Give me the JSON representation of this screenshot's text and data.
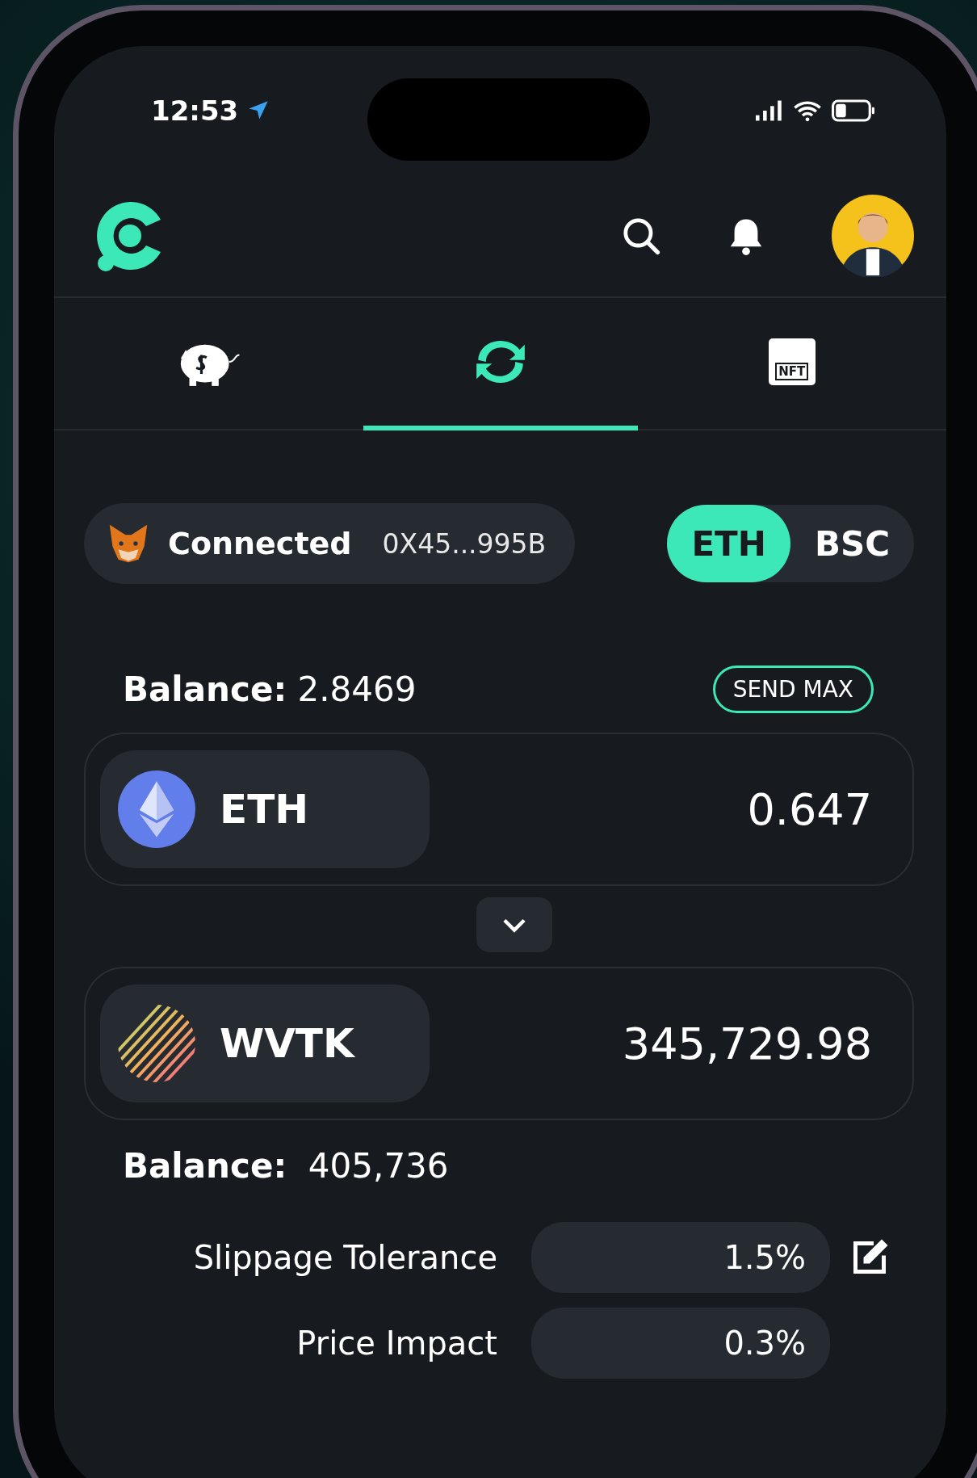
{
  "status_bar": {
    "time": "12:53"
  },
  "tabs": [
    {
      "kind": "piggy",
      "selected": false
    },
    {
      "kind": "swap",
      "selected": true
    },
    {
      "kind": "store",
      "badge": "NFT",
      "selected": false
    }
  ],
  "wallet": {
    "status": "Connected",
    "address": "0X45...995B"
  },
  "networks": [
    {
      "label": "ETH",
      "selected": true
    },
    {
      "label": "BSC",
      "selected": false
    }
  ],
  "from": {
    "balance_label": "Balance:",
    "balance": "2.8469",
    "send_max": "SEND MAX",
    "token": "ETH",
    "amount": "0.647"
  },
  "to": {
    "token": "WVTK",
    "amount": "345,729.98",
    "balance_label": "Balance:",
    "balance": "405,736"
  },
  "details": [
    {
      "label": "Slippage Tolerance",
      "value": "1.5%",
      "editable": true
    },
    {
      "label": "Price Impact",
      "value": "0.3%",
      "editable": false
    }
  ]
}
